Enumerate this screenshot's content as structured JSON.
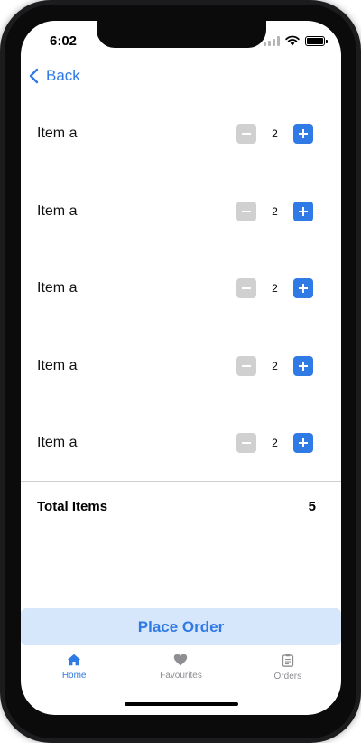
{
  "status_bar": {
    "time": "6:02"
  },
  "nav": {
    "back_label": "Back"
  },
  "items": [
    {
      "name": "Item a",
      "quantity": "2"
    },
    {
      "name": "Item a",
      "quantity": "2"
    },
    {
      "name": "Item a",
      "quantity": "2"
    },
    {
      "name": "Item a",
      "quantity": "2"
    },
    {
      "name": "Item a",
      "quantity": "2"
    }
  ],
  "summary": {
    "total_label": "Total Items",
    "total_value": "5"
  },
  "actions": {
    "place_order_label": "Place Order"
  },
  "tabs": [
    {
      "label": "Home",
      "icon": "home-icon",
      "active": true
    },
    {
      "label": "Favourites",
      "icon": "heart-icon",
      "active": false
    },
    {
      "label": "Orders",
      "icon": "clipboard-icon",
      "active": false
    }
  ],
  "colors": {
    "accent": "#2f7ae5",
    "place_order_bg": "#d6e6fb",
    "minus_bg": "#d0d0d0",
    "inactive_tab": "#8e8e93"
  }
}
